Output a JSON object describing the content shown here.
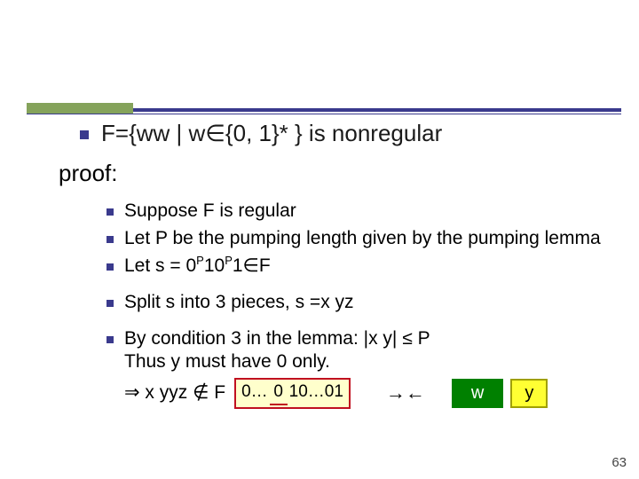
{
  "title": "F={ww | w∈{0, 1}* } is nonregular",
  "proof_label": "proof:",
  "items": [
    "Suppose F is regular",
    "Let P be the pumping length given by the pumping lemma",
    "Let s = 0ᴾ10ᴾ1∈F",
    "Split s into 3 pieces, s =x yz",
    "By condition 3 in the lemma: |x y| ≤ P\nThus y must have 0 only."
  ],
  "conclusion_prefix": "⇒  x yyz ∉ F",
  "string_box_left": "0…",
  "string_box_mid": "0",
  "string_box_right": "10…01",
  "arrows": "→←",
  "chip_w": "w",
  "chip_y": "y",
  "page": "63"
}
